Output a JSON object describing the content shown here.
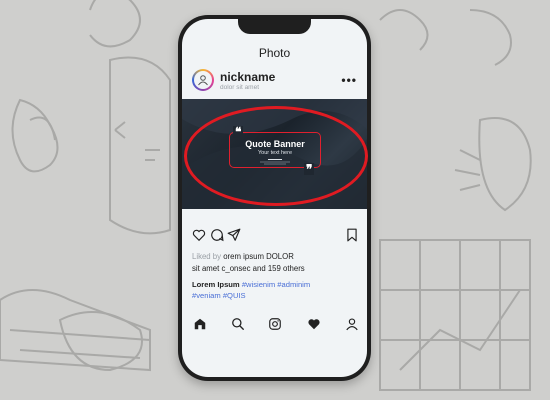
{
  "screen": {
    "title": "Photo"
  },
  "post": {
    "nickname": "nickname",
    "subline": "dolor sit amet",
    "banner": {
      "title": "Quote Banner",
      "subtitle": "Your text here"
    },
    "likes": {
      "prefix": "Liked by",
      "user": "orem ipsum DOLOR",
      "line2": "sit amet c_onsec and 159 others"
    },
    "caption": {
      "author": "Lorem Ipsum",
      "tag1": "#wisienim",
      "tag2": "#adminim",
      "tag3": "#veniam",
      "tag4": "#QUIS"
    }
  },
  "icons": {
    "post_actions": [
      "heart-outline-icon",
      "comment-icon",
      "send-icon",
      "bookmark-icon"
    ],
    "tabbar": [
      "home-icon",
      "search-icon",
      "instagram-icon",
      "heart-filled-icon",
      "profile-icon"
    ],
    "more": "more-dots-icon"
  },
  "colors": {
    "highlight_oval": "#e01b22",
    "hashtag": "#4a6fd6",
    "banner_frame": "#e0202e"
  },
  "more_glyph": "•••"
}
